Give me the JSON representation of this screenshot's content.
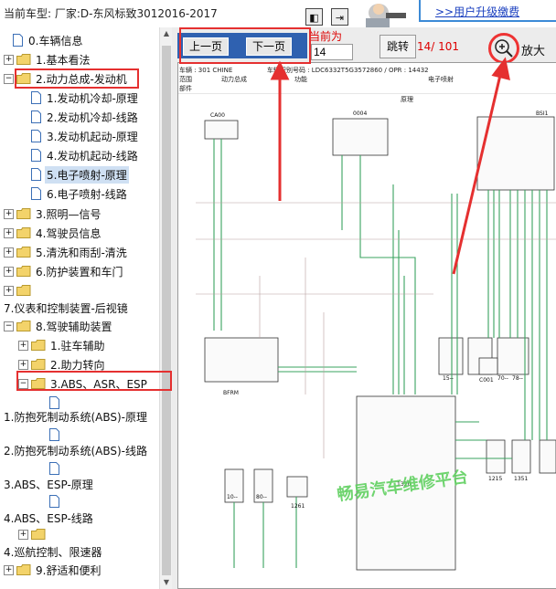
{
  "header": {
    "car_label": "当前车型:  厂家:D-东风标致3012016-2017",
    "upgrade_link": ">>用户升级缴费",
    "btn_prev_icon": "◧",
    "btn_next_icon": "⇥"
  },
  "tree": [
    {
      "label": "0.车辆信息"
    },
    {
      "label": "1.基本看法"
    },
    {
      "label": "2.动力总成-发动机"
    },
    {
      "label": "1.发动机冷却-原理"
    },
    {
      "label": "2.发动机冷却-线路"
    },
    {
      "label": "3.发动机起动-原理"
    },
    {
      "label": "4.发动机起动-线路"
    },
    {
      "label": "5.电子喷射-原理"
    },
    {
      "label": "6.电子喷射-线路"
    },
    {
      "label": "3.照明—信号"
    },
    {
      "label": "4.驾驶员信息"
    },
    {
      "label": "5.清洗和雨刮-清洗"
    },
    {
      "label": "6.防护装置和车门"
    },
    {
      "label": ""
    },
    {
      "label": "7.仪表和控制装置-后视镜"
    },
    {
      "label": "8.驾驶辅助装置"
    },
    {
      "label": "1.驻车辅助"
    },
    {
      "label": "2.助力转向"
    },
    {
      "label": "3.ABS、ASR、ESP"
    },
    {
      "label": ""
    },
    {
      "label": "1.防抱死制动系统(ABS)-原理"
    },
    {
      "label": ""
    },
    {
      "label": "2.防抱死制动系统(ABS)-线路"
    },
    {
      "label": ""
    },
    {
      "label": "3.ABS、ESP-原理"
    },
    {
      "label": ""
    },
    {
      "label": "4.ABS、ESP-线路"
    },
    {
      "label": ""
    },
    {
      "label": "4.巡航控制、限速器"
    },
    {
      "label": "9.舒适和便利"
    }
  ],
  "toolbar": {
    "prev_label": "上一页",
    "next_label": "下一页",
    "current_label": "当前为",
    "page_value": "14",
    "jump_label": "跳转",
    "page_count": "14/ 101",
    "zoom_label": "放大"
  },
  "document": {
    "vehicle": "车辆 : 301 CHINE",
    "vin": "车辆识别号码 : LDC6332T5G3572860 / OPR : 14432",
    "scope_label": "范围",
    "scope_value": "动力总成",
    "function_label": "功能",
    "function_value": "电子喷射",
    "part_label": "部件",
    "principle_label": "原理",
    "labels": [
      "CA00",
      "0004",
      "BSI1",
      "BFRM",
      "C001",
      "1320",
      "1261",
      "1215",
      "1351",
      "15--",
      "70--",
      "78--",
      "10--",
      "80--"
    ],
    "watermark": "畅易汽车维修平台"
  },
  "colors": {
    "accent": "#2f61b0",
    "annotation": "#e53030",
    "wire": "#3aa35f"
  }
}
